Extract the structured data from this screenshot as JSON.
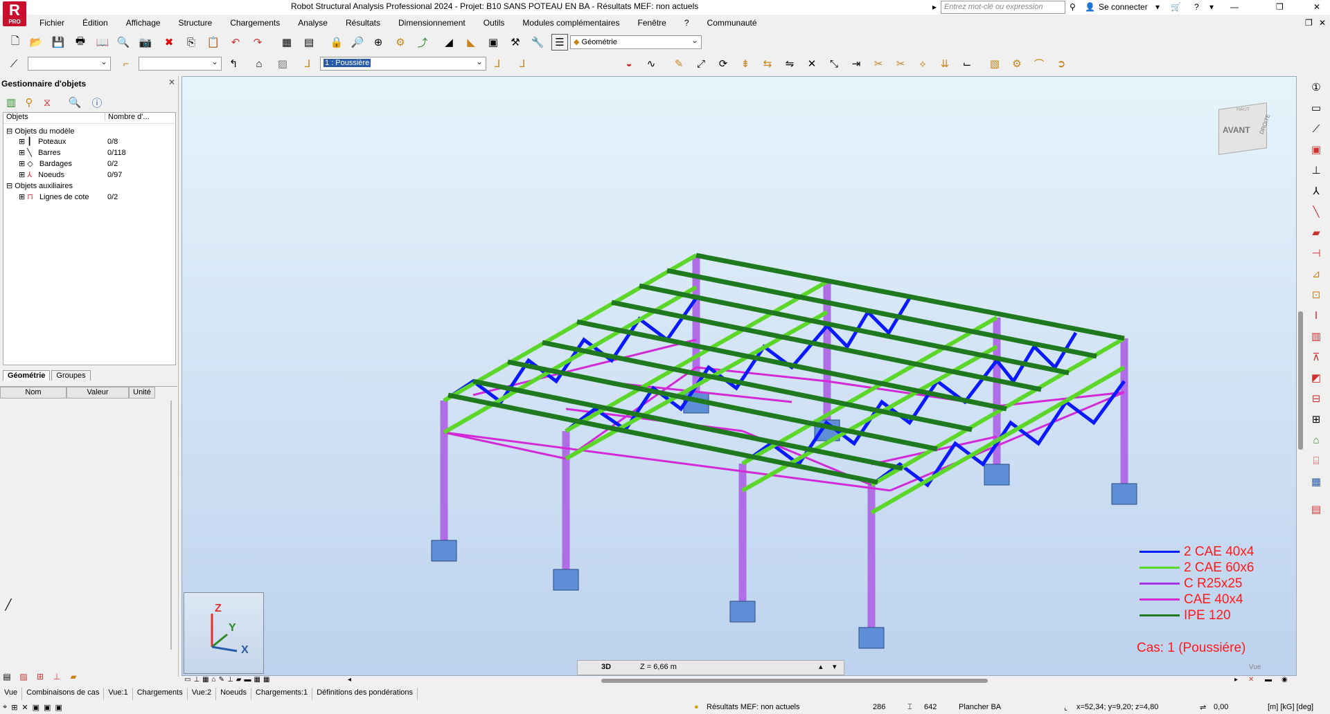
{
  "app": {
    "title": "Robot Structural Analysis Professional 2024 - Projet: B10 SANS POTEAU EN BA - Résultats MEF: non actuels",
    "logo_letter": "R",
    "logo_sub": "PRO",
    "search_placeholder": "Entrez mot-clé ou expression",
    "sign_in": "Se connecter"
  },
  "menu": [
    "Fichier",
    "Édition",
    "Affichage",
    "Structure",
    "Chargements",
    "Analyse",
    "Résultats",
    "Dimensionnement",
    "Outils",
    "Modules complémentaires",
    "Fenêtre",
    "?",
    "Communauté"
  ],
  "toolbar": {
    "view_combo": "Géométrie",
    "load_case_combo": "1 : Poussière"
  },
  "object_manager": {
    "title": "Gestionnaire d'objets",
    "col_objects": "Objets",
    "col_count": "Nombre d'...",
    "model_objects": "Objets du modèle",
    "items": [
      {
        "label": "Poteaux",
        "count": "0/8"
      },
      {
        "label": "Barres",
        "count": "0/118"
      },
      {
        "label": "Bardages",
        "count": "0/2"
      },
      {
        "label": "Noeuds",
        "count": "0/97"
      }
    ],
    "aux_objects": "Objets auxiliaires",
    "aux_items": [
      {
        "label": "Lignes de cote",
        "count": "0/2"
      }
    ],
    "tabs": [
      "Géométrie",
      "Groupes"
    ],
    "props_headers": [
      "Nom",
      "Valeur",
      "Unité"
    ]
  },
  "viewport": {
    "viewcube_front": "AVANT",
    "viewcube_right": "DROITE",
    "viewcube_top": "HAUT",
    "axis_z": "Z",
    "axis_y": "Y",
    "axis_x": "X",
    "view_mode": "3D",
    "z_level": "Z = 6,66 m",
    "corner_label": "Vue",
    "case_label": "Cas: 1 (Poussiére)"
  },
  "legend": [
    {
      "label": "2 CAE 40x4",
      "color": "#0a1aff"
    },
    {
      "label": "2 CAE 60x6",
      "color": "#5dd62a"
    },
    {
      "label": "C R25x25",
      "color": "#a832e8"
    },
    {
      "label": "CAE 40x4",
      "color": "#d22ad6"
    },
    {
      "label": "IPE 120",
      "color": "#1f7a1f"
    }
  ],
  "bottom_tabs": [
    "Vue",
    "Combinaisons de cas",
    "Vue:1",
    "Chargements",
    "Vue:2",
    "Noeuds",
    "Chargements:1",
    "Définitions des pondérations"
  ],
  "status": {
    "results": "Résultats MEF: non actuels",
    "nodes": "286",
    "bars": "642",
    "section": "Plancher BA",
    "coords": "x=52,34; y=9,20; z=4,80",
    "angle": "0,00",
    "units": "[m] [kG] [deg]"
  }
}
